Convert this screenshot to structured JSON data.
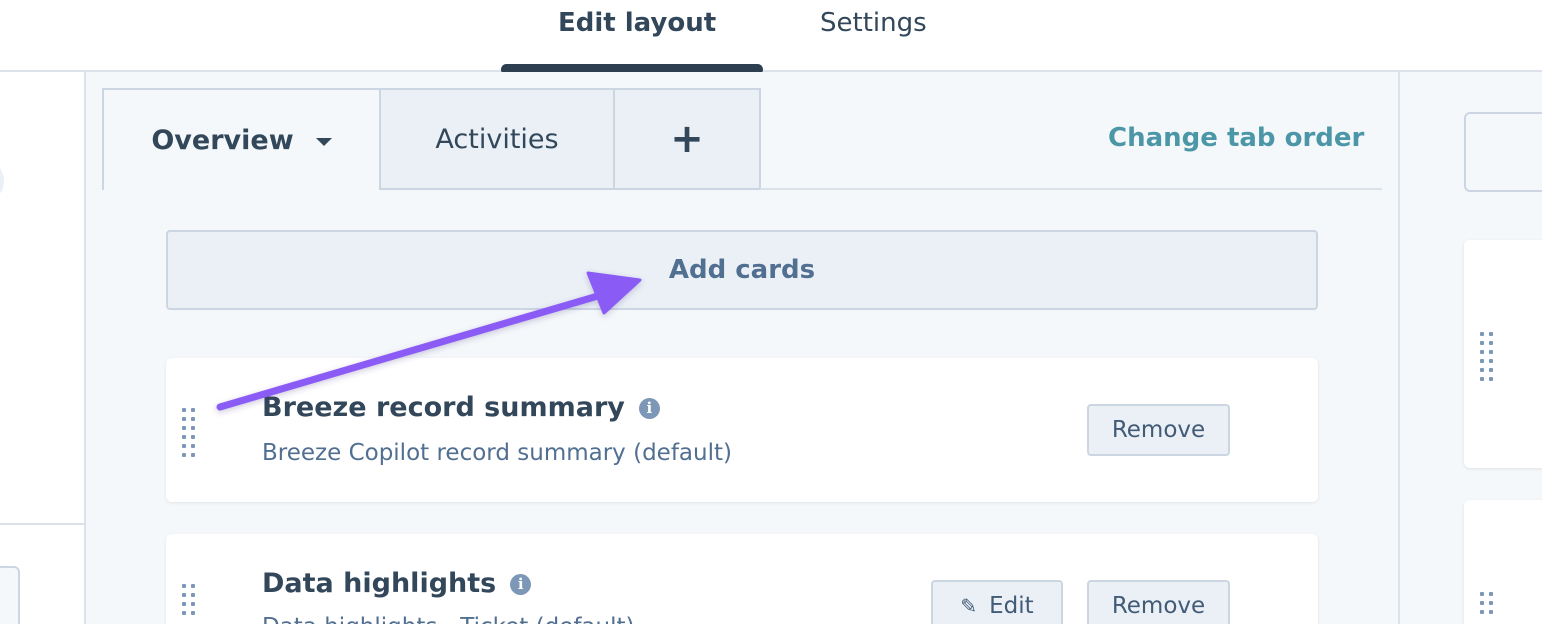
{
  "top_tabs": {
    "edit_layout": "Edit layout",
    "settings": "Settings"
  },
  "card_tabs": {
    "overview": "Overview",
    "activities": "Activities",
    "add": "+"
  },
  "change_tab_order": "Change tab order",
  "add_cards": "Add cards",
  "cards": [
    {
      "title": "Breeze record summary",
      "subtitle": "Breeze Copilot record summary (default)",
      "remove": "Remove"
    },
    {
      "title": "Data highlights",
      "subtitle": "Data highlights - Ticket (default)",
      "edit": "Edit",
      "remove": "Remove"
    }
  ],
  "icons": {
    "info": "i",
    "pencil": "✎"
  },
  "colors": {
    "accent_link": "#4c97a7",
    "annotation_arrow": "#8a5cf5",
    "text_primary": "#33475b"
  }
}
